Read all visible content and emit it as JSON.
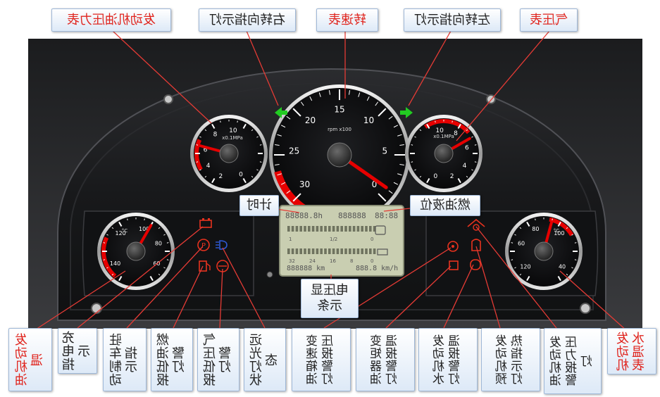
{
  "top_labels": {
    "oil_pressure_gauge": "发动机油压力表",
    "right_turn": "右转向指示灯",
    "tachometer": "转速表",
    "left_turn": "左转向指示灯",
    "air_pressure_gauge": "气压表"
  },
  "mid_labels": {
    "clock": "计时",
    "fuel_level": "燃油液位",
    "voltage": "电压显示条"
  },
  "bottom_labels": {
    "oil_temp": "发动机油温",
    "charging": "充电指示",
    "parking_brake": "驻车制动指示",
    "fuel_low": "燃油低报警灯",
    "air_low": "气压低报警灯",
    "high_beam": "远光灯状态",
    "trans_oil_pressure": "变速箱油压报警灯",
    "torque_oil_temp": "变矩器油温报警灯",
    "engine_water_temp_alarm": "发动机水温报警灯",
    "engine_preheat": "发动机预热指示灯",
    "engine_oil_pressure_alarm": "发动机油压力报警灯",
    "water_temp_gauge": "发动机水温表"
  },
  "colors": {
    "label_red": "#e0251e",
    "label_text": "#222222",
    "gauge_red": "#e60000",
    "turn_green": "#22cc22",
    "warning_red": "#e8321e",
    "beam_blue": "#2e5bd8",
    "lcd_bg": "#c9ceb1"
  },
  "tachometer": {
    "unit": "rpm x100",
    "ticks": [
      "30",
      "25",
      "20",
      "15",
      "10",
      "5",
      "0"
    ]
  },
  "oil_pressure": {
    "unit": "x0.1MPa",
    "ticks": [
      "10",
      "8",
      "6",
      "4",
      "2",
      "0"
    ]
  },
  "air_pressure": {
    "unit": "x0.1MPa",
    "ticks": [
      "10",
      "8",
      "6",
      "4",
      "2",
      "0"
    ]
  },
  "oil_temp": {
    "unit": "°C",
    "ticks": [
      "100",
      "120",
      "140",
      "80",
      "60"
    ]
  },
  "water_temp": {
    "unit": "°C",
    "ticks": [
      "80",
      "60",
      "120",
      "100",
      "40"
    ]
  },
  "lcd": {
    "odo_top": "88888.8h",
    "trip_top": "888888",
    "clock": "88:88",
    "odo_bottom": "888888 km",
    "speed": "888.8 km/h",
    "bar_scale_1": [
      "1",
      "1/2",
      "0"
    ],
    "bar_scale_2": [
      "32",
      "24",
      "16",
      "8",
      "0"
    ]
  },
  "icons": [
    "battery-icon",
    "parking-brake-icon",
    "high-beam-icon",
    "fuel-low-icon",
    "air-low-icon",
    "trans-temp-icon",
    "preheat-icon",
    "oil-pressure-icon",
    "water-temp-icon"
  ]
}
